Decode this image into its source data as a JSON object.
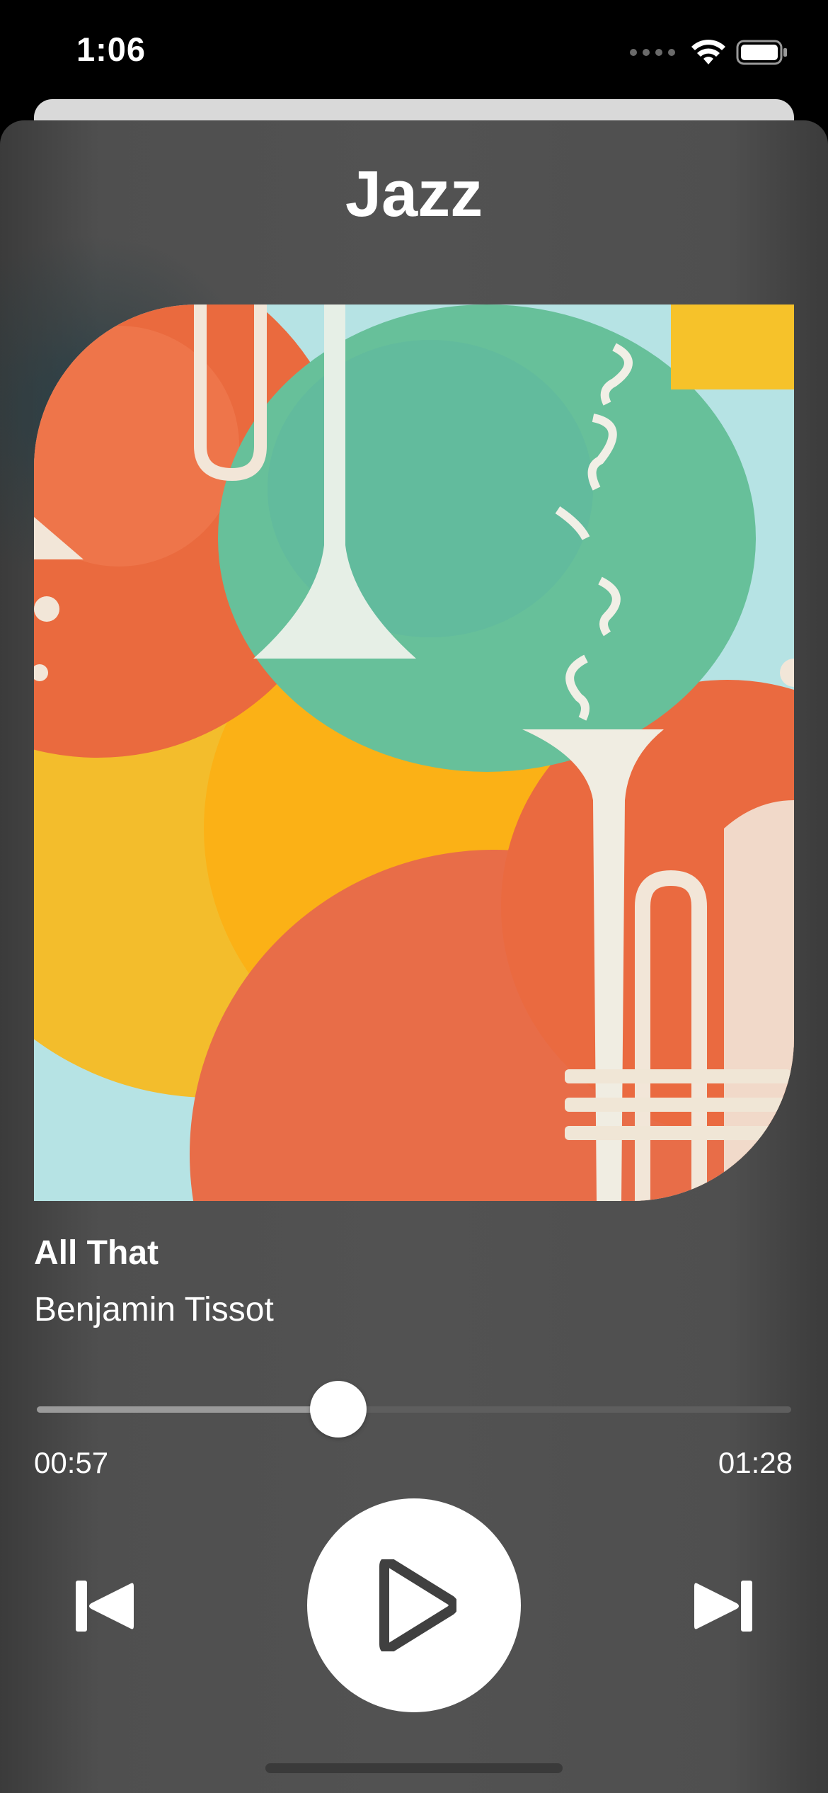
{
  "status_bar": {
    "time": "1:06",
    "icons": [
      "cellular-dots-icon",
      "wifi-icon",
      "battery-icon"
    ]
  },
  "player": {
    "title": "Jazz",
    "track": {
      "title": "All That",
      "artist": "Benjamin Tissot"
    },
    "progress": {
      "elapsed": "00:57",
      "total": "01:28",
      "fraction": 0.4
    },
    "controls": {
      "previous_icon": "skip-back-icon",
      "play_icon": "play-icon",
      "next_icon": "skip-forward-icon"
    },
    "artwork": "jazz-trumpets-artwork"
  },
  "colors": {
    "sheet_background": "#525252",
    "text": "#ffffff",
    "artwork_green": "#6cbf9a",
    "artwork_yellow": "#f6b81f",
    "artwork_orange": "#ea6c45",
    "artwork_lightblue": "#b6e3e4"
  }
}
